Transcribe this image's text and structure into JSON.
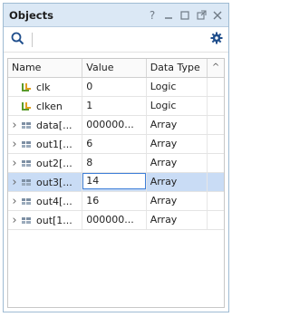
{
  "panel": {
    "title": "Objects"
  },
  "toolbar": {
    "search_icon": "search-icon",
    "settings_icon": "gear-icon"
  },
  "table": {
    "headers": [
      "Name",
      "Value",
      "Data Type"
    ],
    "rows": [
      {
        "name": "clk",
        "value": "0",
        "type": "Logic",
        "expandable": false,
        "icon": "logic-signal-icon"
      },
      {
        "name": "clken",
        "value": "1",
        "type": "Logic",
        "expandable": false,
        "icon": "logic-signal-icon"
      },
      {
        "name": "data[...",
        "value": "000000...",
        "type": "Array",
        "expandable": true,
        "icon": "array-icon"
      },
      {
        "name": "out1[...",
        "value": "6",
        "type": "Array",
        "expandable": true,
        "icon": "array-icon"
      },
      {
        "name": "out2[...",
        "value": "8",
        "type": "Array",
        "expandable": true,
        "icon": "array-icon"
      },
      {
        "name": "out3[...",
        "value": "14",
        "type": "Array",
        "expandable": true,
        "icon": "array-icon",
        "selected": true
      },
      {
        "name": "out4[...",
        "value": "16",
        "type": "Array",
        "expandable": true,
        "icon": "array-icon"
      },
      {
        "name": "out[1...",
        "value": "000000...",
        "type": "Array",
        "expandable": true,
        "icon": "array-icon"
      }
    ]
  },
  "colors": {
    "title_bar": "#dbe8f5",
    "selection": "#c9dcf5",
    "edit_border": "#3e7fd9"
  }
}
